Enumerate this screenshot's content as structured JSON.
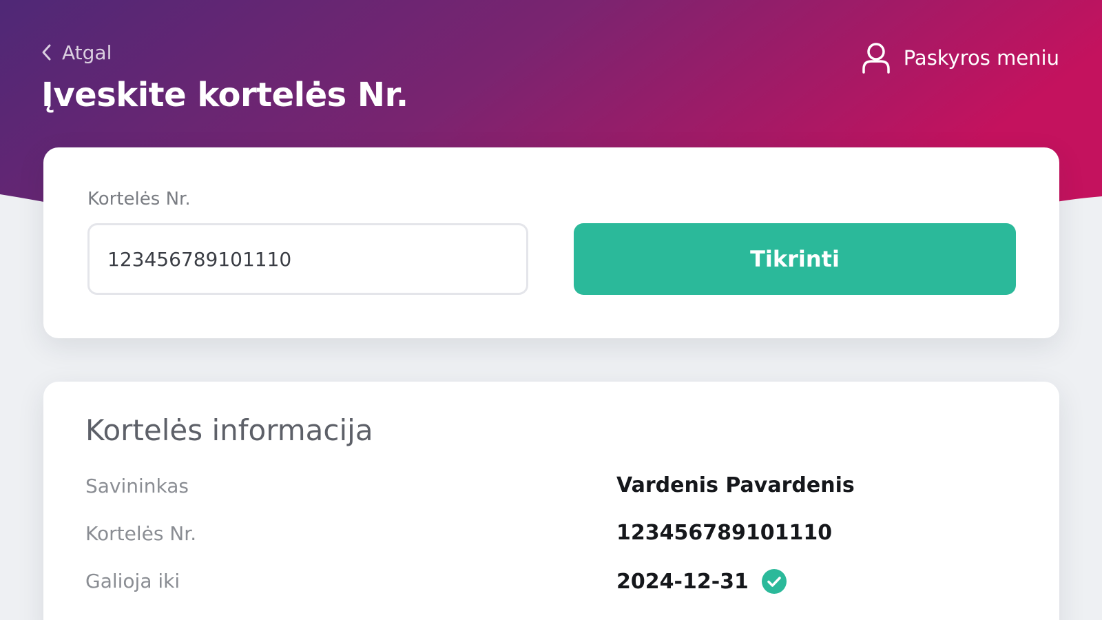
{
  "header": {
    "back_label": "Atgal",
    "title": "Įveskite kortelės Nr.",
    "account_menu_label": "Paskyros meniu"
  },
  "search": {
    "field_label": "Kortelės Nr.",
    "input_value": "123456789101110",
    "button_label": "Tikrinti"
  },
  "card_info": {
    "title": "Kortelės informacija",
    "rows": [
      {
        "label": "Savininkas",
        "value": "Vardenis Pavardenis"
      },
      {
        "label": "Kortelės Nr.",
        "value": "123456789101110"
      },
      {
        "label": "Galioja iki",
        "value": "2024-12-31"
      }
    ],
    "valid_status_icon": "check-circle-icon"
  },
  "colors": {
    "header_gradient_start": "#4f2876",
    "header_gradient_mid": "#7a2470",
    "header_gradient_end": "#c4125e",
    "accent_green": "#2bb99a",
    "page_background": "#eef0f3"
  }
}
